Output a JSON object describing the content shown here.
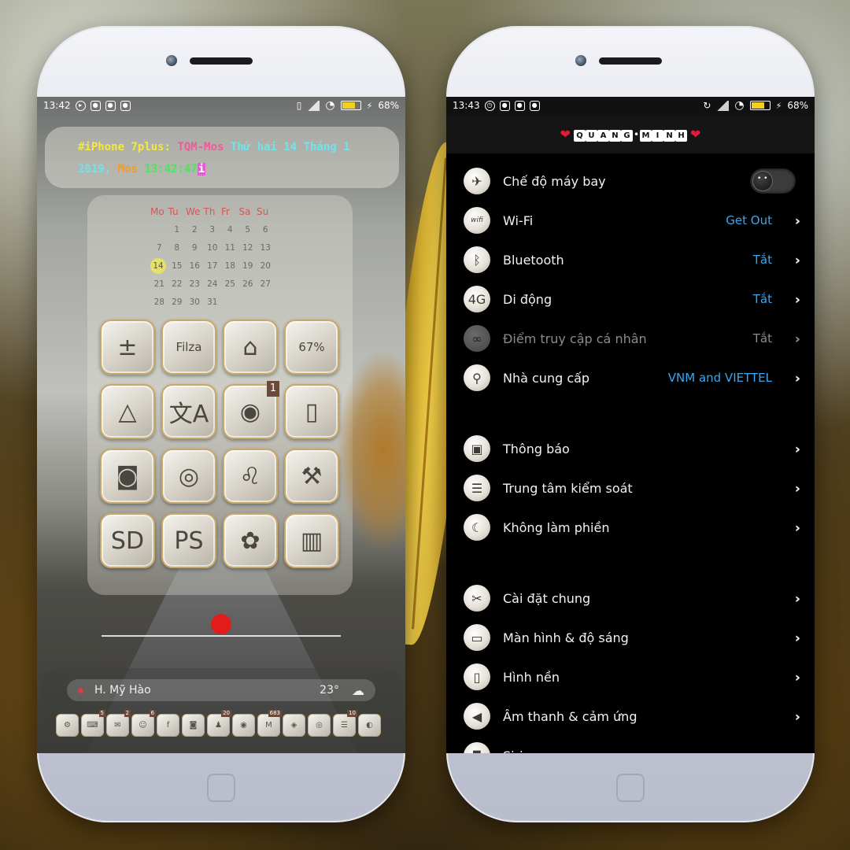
{
  "left_phone": {
    "status": {
      "time": "13:42",
      "battery": "68%",
      "battery_level": 0.68
    },
    "terminal": {
      "prompt": "#iPhone 7plus:",
      "user": "TQM-Mos",
      "date_line1": "Thứ hai 14 Tháng 1",
      "date_line2": "2019,",
      "location": "Mos",
      "clock": "13:42:47",
      "cursor": "i"
    },
    "calendar": {
      "headers": [
        "Mo",
        "Tu",
        "We",
        "Th",
        "Fr",
        "Sa",
        "Su"
      ],
      "weeks": [
        [
          "",
          "1",
          "2",
          "3",
          "4",
          "5",
          "6"
        ],
        [
          "7",
          "8",
          "9",
          "10",
          "11",
          "12",
          "13"
        ],
        [
          "14",
          "15",
          "16",
          "17",
          "18",
          "19",
          "20"
        ],
        [
          "21",
          "22",
          "23",
          "24",
          "25",
          "26",
          "27"
        ],
        [
          "28",
          "29",
          "30",
          "31",
          "",
          "",
          ""
        ]
      ],
      "today": "14"
    },
    "apps": [
      {
        "name": "calculator-icon",
        "glyph": "±",
        "badge": ""
      },
      {
        "name": "filza-icon",
        "glyph": "Filza",
        "badge": ""
      },
      {
        "name": "hangover-icon",
        "glyph": "⌂",
        "badge": ""
      },
      {
        "name": "battery-app-icon",
        "glyph": "67%",
        "badge": ""
      },
      {
        "name": "drive-icon",
        "glyph": "△",
        "badge": ""
      },
      {
        "name": "translate-icon",
        "glyph": "文A",
        "badge": ""
      },
      {
        "name": "camera-lens-icon",
        "glyph": "◉",
        "badge": "1"
      },
      {
        "name": "phone-add-icon",
        "glyph": "▯",
        "badge": ""
      },
      {
        "name": "photo-camera-icon",
        "glyph": "◙",
        "badge": ""
      },
      {
        "name": "joystick-icon",
        "glyph": "◎",
        "badge": ""
      },
      {
        "name": "lion-icon",
        "glyph": "♌",
        "badge": ""
      },
      {
        "name": "drill-icon",
        "glyph": "⚒",
        "badge": ""
      },
      {
        "name": "sd-card-icon",
        "glyph": "SD",
        "badge": ""
      },
      {
        "name": "playstation-icon",
        "glyph": "PS",
        "badge": ""
      },
      {
        "name": "flower-icon",
        "glyph": "✿",
        "badge": ""
      },
      {
        "name": "book-icon",
        "glyph": "▥",
        "badge": ""
      }
    ],
    "weather": {
      "location": "H. Mỹ Hào",
      "temp": "23°",
      "condition_icon": "cloud-sun-icon"
    },
    "dock": [
      {
        "name": "settings-dock-icon",
        "glyph": "⚙",
        "badge": ""
      },
      {
        "name": "keyboard-dock-icon",
        "glyph": "⌨",
        "badge": "5"
      },
      {
        "name": "messages-dock-icon",
        "glyph": "✉",
        "badge": "2"
      },
      {
        "name": "chat-dock-icon",
        "glyph": "☺",
        "badge": "6"
      },
      {
        "name": "facebook-dock-icon",
        "glyph": "f",
        "badge": ""
      },
      {
        "name": "camera-dock-icon",
        "glyph": "◙",
        "badge": ""
      },
      {
        "name": "people-dock-icon",
        "glyph": "♟",
        "badge": "20"
      },
      {
        "name": "robot-dock-icon",
        "glyph": "◉",
        "badge": ""
      },
      {
        "name": "mail-dock-icon",
        "glyph": "M",
        "badge": "683"
      },
      {
        "name": "box-dock-icon",
        "glyph": "◈",
        "badge": ""
      },
      {
        "name": "music-dock-icon",
        "glyph": "◎",
        "badge": ""
      },
      {
        "name": "contacts-dock-icon",
        "glyph": "☰",
        "badge": "10"
      },
      {
        "name": "color-dock-icon",
        "glyph": "◐",
        "badge": ""
      }
    ]
  },
  "right_phone": {
    "status": {
      "time": "13:43",
      "battery": "68%",
      "battery_level": 0.68
    },
    "brand": {
      "letters": [
        "Q",
        "U",
        "A",
        "N",
        "G",
        "M",
        "I",
        "N",
        "H"
      ]
    },
    "group1": [
      {
        "name": "airplane-mode",
        "icon": "airplane-icon",
        "glyph": "✈",
        "label": "Chế độ máy bay",
        "value": "",
        "toggle": true,
        "dim": false
      },
      {
        "name": "wifi",
        "icon": "wifi-icon",
        "glyph": "wifi",
        "label": "Wi-Fi",
        "value": "Get Out",
        "toggle": false,
        "dim": false
      },
      {
        "name": "bluetooth",
        "icon": "bluetooth-icon",
        "glyph": "ᛒ",
        "label": "Bluetooth",
        "value": "Tắt",
        "toggle": false,
        "dim": false
      },
      {
        "name": "mobile-data",
        "icon": "cellular-4g-icon",
        "glyph": "4G",
        "label": "Di động",
        "value": "Tắt",
        "toggle": false,
        "dim": false
      },
      {
        "name": "personal-hotspot",
        "icon": "hotspot-icon",
        "glyph": "∞",
        "label": "Điểm truy cập cá nhân",
        "value": "Tắt",
        "toggle": false,
        "dim": true
      },
      {
        "name": "carrier",
        "icon": "antenna-icon",
        "glyph": "⚲",
        "label": "Nhà cung cấp",
        "value": "VNM and VIETTEL",
        "toggle": false,
        "dim": false
      }
    ],
    "group2": [
      {
        "name": "notifications",
        "icon": "notification-icon",
        "glyph": "▣",
        "label": "Thông báo",
        "value": ""
      },
      {
        "name": "control-center",
        "icon": "sliders-icon",
        "glyph": "☰",
        "label": "Trung tâm kiểm soát",
        "value": ""
      },
      {
        "name": "do-not-disturb",
        "icon": "moon-icon",
        "glyph": "☾",
        "label": "Không làm phiền",
        "value": ""
      }
    ],
    "group3": [
      {
        "name": "general",
        "icon": "tools-icon",
        "glyph": "✂",
        "label": "Cài đặt chung",
        "value": ""
      },
      {
        "name": "display-brightness",
        "icon": "monitor-icon",
        "glyph": "▭",
        "label": "Màn hình & độ sáng",
        "value": ""
      },
      {
        "name": "wallpaper",
        "icon": "wallpaper-icon",
        "glyph": "▯",
        "label": "Hình nền",
        "value": ""
      },
      {
        "name": "sounds-haptics",
        "icon": "speaker-icon",
        "glyph": "◀",
        "label": "Âm thanh & cảm ứng",
        "value": ""
      },
      {
        "name": "siri",
        "icon": "microphone-icon",
        "glyph": "◘",
        "label": "Siri",
        "value": ""
      }
    ]
  }
}
